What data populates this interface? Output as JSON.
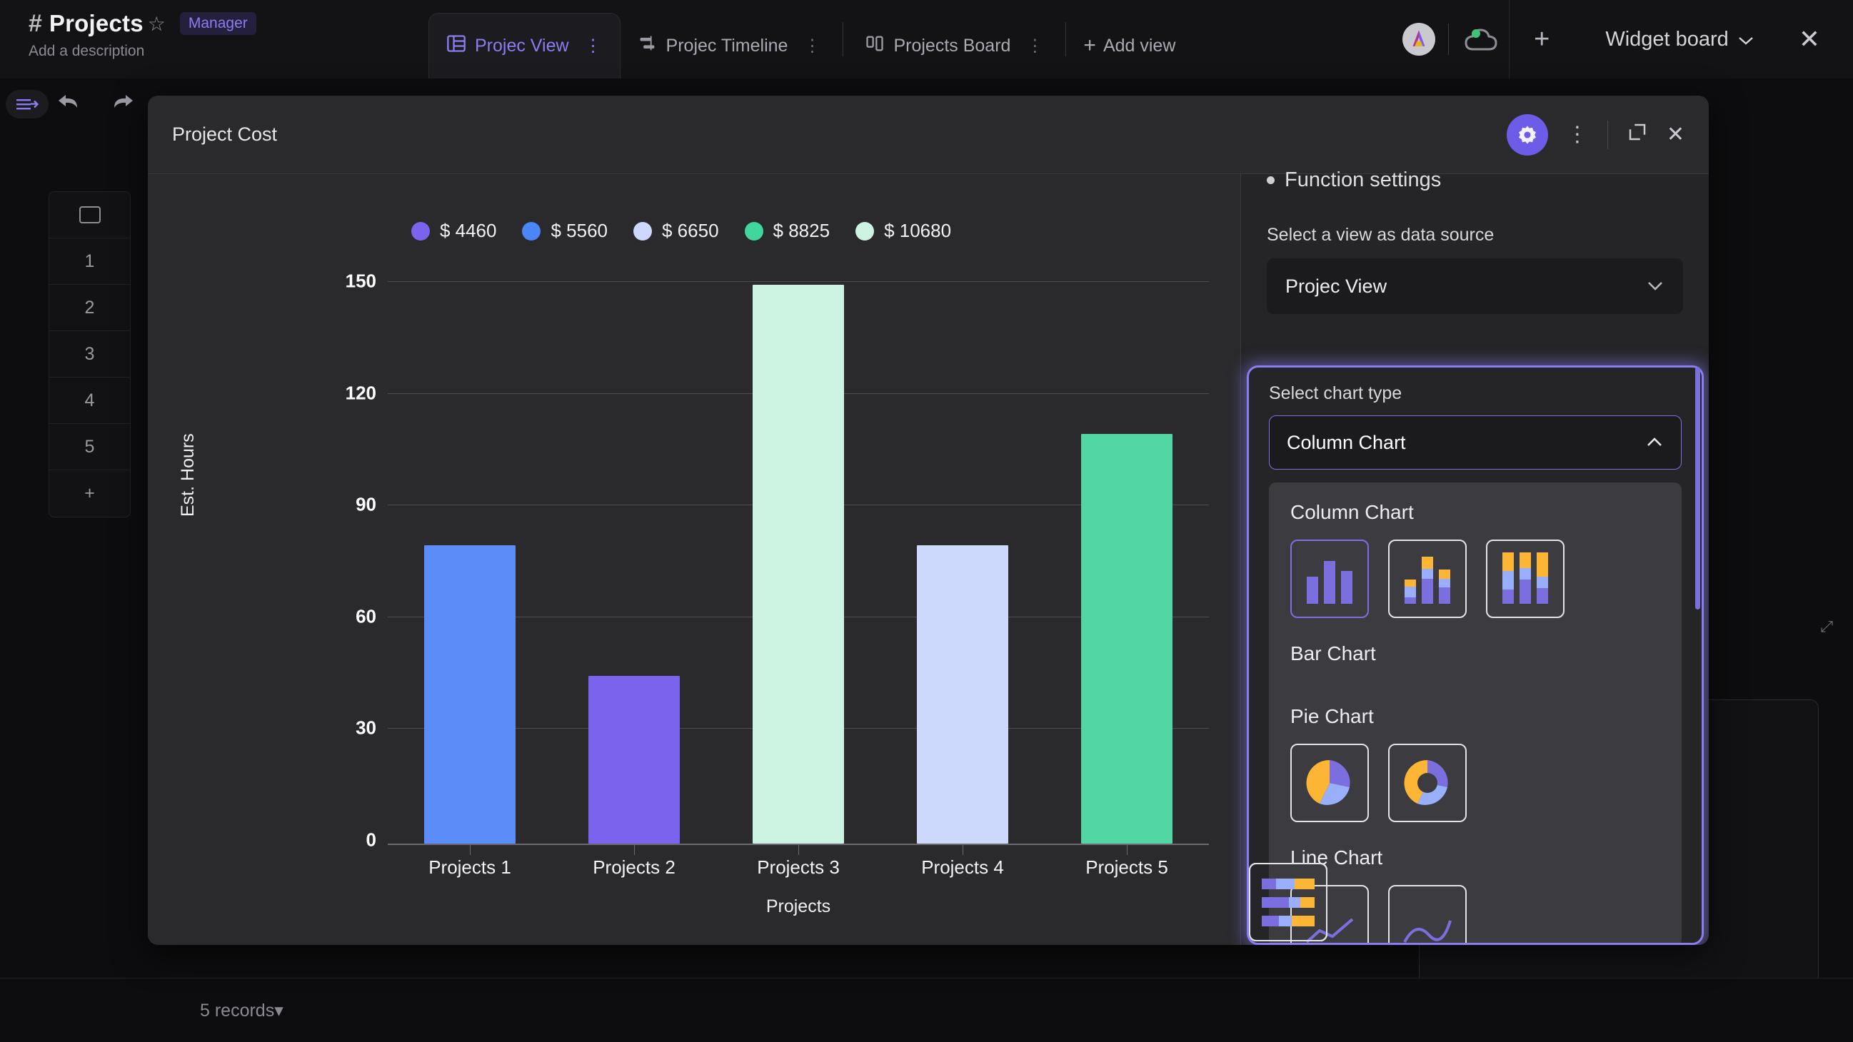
{
  "topbar": {
    "hash_icon": "#",
    "workspace_title": "Projects",
    "star_icon": "☆",
    "role_badge": "Manager",
    "description": "Add a description",
    "tabs": [
      {
        "label": "Projec View",
        "icon": "table-icon",
        "active": true
      },
      {
        "label": "Projec Timeline",
        "icon": "timeline-icon",
        "active": false
      },
      {
        "label": "Projects Board",
        "icon": "board-icon",
        "active": false
      }
    ],
    "add_view": "Add view",
    "add_view_plus": "+",
    "plus_button": "+",
    "widget_board": "Widget board",
    "widget_board_chevron": "⌄",
    "close": "✕"
  },
  "left_rail": {
    "panel_toggle_icon": "collapse-panel-icon",
    "undo_icon": "➦",
    "redo_icon": "➦",
    "row_header_icon": "checkbox-icon",
    "rows": [
      "1",
      "2",
      "3",
      "4",
      "5"
    ],
    "add_row": "+"
  },
  "footer": {
    "records": "5 records",
    "records_chevron": "▾"
  },
  "modal": {
    "title": "Project Cost",
    "gear_icon": "gear-icon",
    "kebab_icon": "⋮",
    "expand_icon": "⬚",
    "close_icon": "✕"
  },
  "settings": {
    "function_settings": "Function settings",
    "data_source_label": "Select a view as data source",
    "data_source_value": "Projec View",
    "data_source_chevron": "⌄",
    "chart_type_label": "Select chart type",
    "chart_type_value": "Column Chart",
    "chart_type_chevron": "⌃",
    "sections": [
      {
        "title": "Column Chart",
        "options": [
          "column-basic",
          "column-stacked",
          "column-stacked-full"
        ]
      },
      {
        "title": "Bar Chart",
        "options": [
          "bar-basic",
          "bar-stacked",
          "bar-stacked-full"
        ]
      },
      {
        "title": "Pie Chart",
        "options": [
          "pie-basic",
          "pie-donut"
        ]
      },
      {
        "title": "Line Chart",
        "options": [
          "line-basic",
          "line-smooth"
        ]
      }
    ],
    "selected_option": "column-basic"
  },
  "chart_data": {
    "type": "bar",
    "title": "Project Cost",
    "categories": [
      "Projects 1",
      "Projects 2",
      "Projects 3",
      "Projects 4",
      "Projects 5"
    ],
    "values": [
      80,
      45,
      150,
      80,
      110
    ],
    "colors": [
      "#5b8cf7",
      "#7c63ee",
      "#cdf3e3",
      "#ccd9fc",
      "#52d6a4"
    ],
    "xlabel": "Projects",
    "ylabel": "Est. Hours",
    "ylim": [
      0,
      150
    ],
    "yticks": [
      0,
      30,
      60,
      90,
      120,
      150
    ],
    "grid": true,
    "legend_position": "top",
    "legend": [
      {
        "label": "$ 4460",
        "color": "#7c63ee"
      },
      {
        "label": "$ 5560",
        "color": "#4a86f7"
      },
      {
        "label": "$ 6650",
        "color": "#ccd9fc"
      },
      {
        "label": "$ 8825",
        "color": "#41d69e"
      },
      {
        "label": "$ 10680",
        "color": "#cdf3e3"
      }
    ]
  },
  "palette": {
    "accent": "#8a7df0",
    "gear_bg": "#6c5ce7",
    "icon_purple": "#7b6fe0",
    "icon_blue": "#9aaffb",
    "icon_yellow": "#fcb535"
  }
}
